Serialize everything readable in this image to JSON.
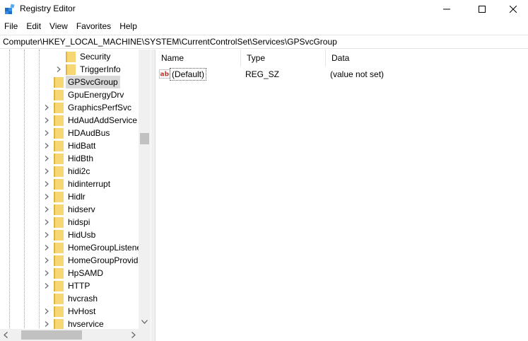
{
  "window": {
    "title": "Registry Editor",
    "icon": "registry-editor-icon"
  },
  "menu": [
    "File",
    "Edit",
    "View",
    "Favorites",
    "Help"
  ],
  "address": "Computer\\HKEY_LOCAL_MACHINE\\SYSTEM\\CurrentControlSet\\Services\\GPSvcGroup",
  "tree": {
    "items": [
      {
        "label": "Security",
        "level": 2,
        "expandable": false,
        "selected": false
      },
      {
        "label": "TriggerInfo",
        "level": 2,
        "expandable": true,
        "selected": false
      },
      {
        "label": "GPSvcGroup",
        "level": 1,
        "expandable": false,
        "selected": true
      },
      {
        "label": "GpuEnergyDrv",
        "level": 1,
        "expandable": false,
        "selected": false
      },
      {
        "label": "GraphicsPerfSvc",
        "level": 1,
        "expandable": true,
        "selected": false
      },
      {
        "label": "HdAudAddService",
        "level": 1,
        "expandable": true,
        "selected": false
      },
      {
        "label": "HDAudBus",
        "level": 1,
        "expandable": true,
        "selected": false
      },
      {
        "label": "HidBatt",
        "level": 1,
        "expandable": true,
        "selected": false
      },
      {
        "label": "HidBth",
        "level": 1,
        "expandable": true,
        "selected": false
      },
      {
        "label": "hidi2c",
        "level": 1,
        "expandable": true,
        "selected": false
      },
      {
        "label": "hidinterrupt",
        "level": 1,
        "expandable": true,
        "selected": false
      },
      {
        "label": "Hidlr",
        "level": 1,
        "expandable": true,
        "selected": false
      },
      {
        "label": "hidserv",
        "level": 1,
        "expandable": true,
        "selected": false
      },
      {
        "label": "hidspi",
        "level": 1,
        "expandable": true,
        "selected": false
      },
      {
        "label": "HidUsb",
        "level": 1,
        "expandable": true,
        "selected": false
      },
      {
        "label": "HomeGroupListene",
        "level": 1,
        "expandable": true,
        "selected": false
      },
      {
        "label": "HomeGroupProvid",
        "level": 1,
        "expandable": true,
        "selected": false
      },
      {
        "label": "HpSAMD",
        "level": 1,
        "expandable": true,
        "selected": false
      },
      {
        "label": "HTTP",
        "level": 1,
        "expandable": true,
        "selected": false
      },
      {
        "label": "hvcrash",
        "level": 1,
        "expandable": false,
        "selected": false
      },
      {
        "label": "HvHost",
        "level": 1,
        "expandable": true,
        "selected": false
      },
      {
        "label": "hvservice",
        "level": 1,
        "expandable": true,
        "selected": false
      }
    ]
  },
  "list": {
    "columns": {
      "name": "Name",
      "type": "Type",
      "data": "Data"
    },
    "rows": [
      {
        "name": "(Default)",
        "type": "REG_SZ",
        "data": "(value not set)",
        "icon": "string-value-icon"
      }
    ]
  },
  "colors": {
    "folder": "#f7d774",
    "folder_dark": "#e0b443",
    "selected_bg": "#d9d9d9",
    "ab_icon": "#c0392b"
  }
}
